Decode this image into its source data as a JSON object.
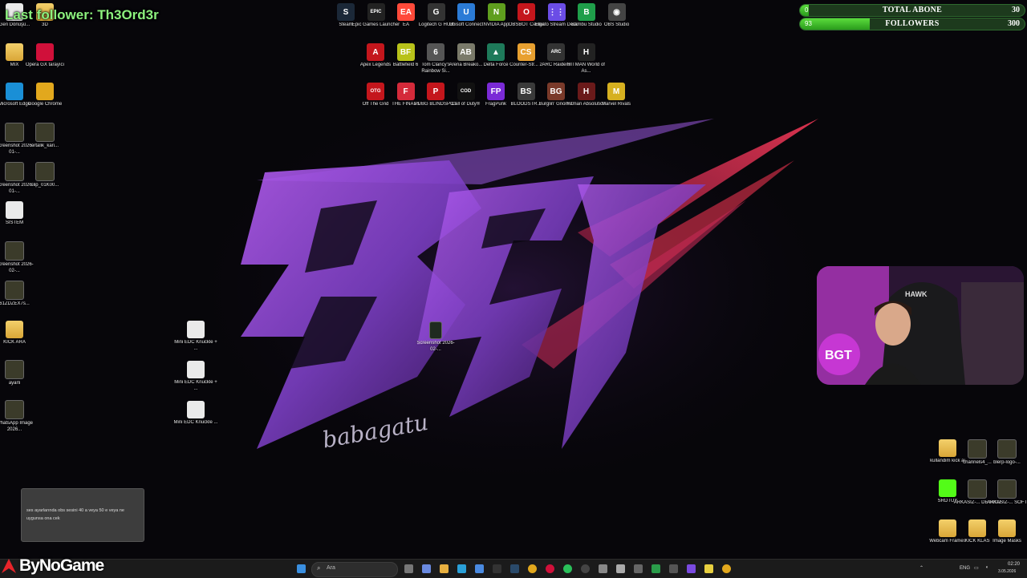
{
  "overlay": {
    "last_follower": "Last follower: Th3Ord3r"
  },
  "stats": [
    {
      "title": "TOTAL ABONE",
      "current": "0",
      "goal": "30",
      "fill_fraction": 0.04
    },
    {
      "title": "FOLLOWERS",
      "current": "93",
      "goal": "300",
      "fill_fraction": 0.31
    }
  ],
  "left_icons": [
    {
      "label": "Geri Dönüşü...",
      "icon": "recycle-bin-icon",
      "kind": "file"
    },
    {
      "label": "3D",
      "icon": "folder-icon",
      "kind": "folder"
    },
    {
      "label": "MIX",
      "icon": "folder-icon",
      "kind": "folder"
    },
    {
      "label": "Opera GX tarayıcı",
      "icon": "opera-gx-icon",
      "kind": "app",
      "color": "#d0103a"
    },
    {
      "label": "Microsoft Edge",
      "icon": "edge-icon",
      "kind": "app",
      "color": "#1a8fd6"
    },
    {
      "label": "Google Chrome",
      "icon": "chrome-icon",
      "kind": "app",
      "color": "#e2a81d"
    },
    {
      "label": "Screenshot 2026-01-...",
      "icon": "image-file-icon",
      "kind": "thumb"
    },
    {
      "label": "ortalik_kari...",
      "icon": "video-file-icon",
      "kind": "thumb"
    },
    {
      "label": "Screenshot 2026-01-...",
      "icon": "image-file-icon",
      "kind": "thumb"
    },
    {
      "label": "clip_01K00...",
      "icon": "video-file-icon",
      "kind": "thumb"
    },
    {
      "label": "SISTEM",
      "icon": "document-icon",
      "kind": "file"
    },
    {
      "label": "Screenshot 2026-02-...",
      "icon": "image-file-icon",
      "kind": "thumb"
    },
    {
      "label": "61ZDZEX7s...",
      "icon": "image-file-icon",
      "kind": "thumb"
    },
    {
      "label": "KICK ARA",
      "icon": "folder-icon",
      "kind": "folder"
    },
    {
      "label": "ayarli",
      "icon": "image-file-icon",
      "kind": "thumb"
    },
    {
      "label": "WhatsApp Image 2026...",
      "icon": "image-file-icon",
      "kind": "thumb"
    }
  ],
  "middle_icons": [
    {
      "label": "Mini EDC Knuckle + ...",
      "icon": "model-file-icon"
    },
    {
      "label": "Mini EDC Knuckle + ...",
      "icon": "model-file-icon"
    },
    {
      "label": "Mini EDC Knuckle ...",
      "icon": "model-file-icon"
    }
  ],
  "center_icon": {
    "label": "Screenshot 2026-02-...",
    "icon": "image-file-icon"
  },
  "top_apps_row1": [
    {
      "label": "Steam",
      "icon": "steam-icon",
      "color": "#1b2838",
      "glyph": "S"
    },
    {
      "label": "Epic Games Launcher",
      "icon": "epic-games-icon",
      "color": "#222",
      "glyph": "EPIC"
    },
    {
      "label": "EA",
      "icon": "ea-icon",
      "color": "#ff4a3a",
      "glyph": "EA"
    },
    {
      "label": "Logitech G HUB",
      "icon": "logitech-icon",
      "color": "#333",
      "glyph": "G"
    },
    {
      "label": "Ubisoft Connect",
      "icon": "ubisoft-icon",
      "color": "#2b7bd6",
      "glyph": "U"
    },
    {
      "label": "NVIDIA App",
      "icon": "nvidia-icon",
      "color": "#5f9e1e",
      "glyph": "N"
    },
    {
      "label": "OBSBOT Center",
      "icon": "obsbot-icon",
      "color": "#c4161c",
      "glyph": "O"
    },
    {
      "label": "Elgato Stream Deck",
      "icon": "stream-deck-icon",
      "color": "#6b4de6",
      "glyph": "⋮⋮"
    },
    {
      "label": "Bambu Studio",
      "icon": "bambu-icon",
      "color": "#1f9e4a",
      "glyph": "B"
    },
    {
      "label": "OBS Studio",
      "icon": "obs-icon",
      "color": "#444",
      "glyph": "◉"
    }
  ],
  "top_apps_row2": [
    {
      "label": "Apex Legends",
      "icon": "apex-icon",
      "color": "#c4161c",
      "glyph": "A"
    },
    {
      "label": "Battlefield 6",
      "icon": "battlefield-icon",
      "color": "#b8c21a",
      "glyph": "BF"
    },
    {
      "label": "Tom Clancy's Rainbow Si...",
      "icon": "rainbow-six-icon",
      "color": "#555",
      "glyph": "6"
    },
    {
      "label": "Arena Breako...",
      "icon": "arena-breakout-icon",
      "color": "#7a7a6a",
      "glyph": "AB"
    },
    {
      "label": "Delta Force",
      "icon": "delta-force-icon",
      "color": "#1e7a5a",
      "glyph": "▲"
    },
    {
      "label": "Counter-Str... 2",
      "icon": "cs2-icon",
      "color": "#e8a030",
      "glyph": "CS"
    },
    {
      "label": "ARC Raiders",
      "icon": "arc-raiders-icon",
      "color": "#333",
      "glyph": "ARC"
    },
    {
      "label": "HITMAN World of As...",
      "icon": "hitman-icon",
      "color": "#222",
      "glyph": "H"
    }
  ],
  "top_apps_row3": [
    {
      "label": "Off The Grid",
      "icon": "off-the-grid-icon",
      "color": "#c4161c",
      "glyph": "OTG"
    },
    {
      "label": "THE FINALS",
      "icon": "the-finals-icon",
      "color": "#d42a3a",
      "glyph": "F"
    },
    {
      "label": "PUBG BLINDSPOT",
      "icon": "pubg-icon",
      "color": "#c4161c",
      "glyph": "P"
    },
    {
      "label": "Call of Duty®",
      "icon": "call-of-duty-icon",
      "color": "#111",
      "glyph": "COD"
    },
    {
      "label": "FragPunk",
      "icon": "fragpunk-icon",
      "color": "#7a2ad6",
      "glyph": "FP"
    },
    {
      "label": "BLOODSTR...",
      "icon": "bloodstrike-icon",
      "color": "#3a3a3a",
      "glyph": "BS"
    },
    {
      "label": "Burglin' Gnom...",
      "icon": "burglin-gnomes-icon",
      "color": "#7a3a2a",
      "glyph": "BG"
    },
    {
      "label": "Hitman Absolution",
      "icon": "hitman-absolution-icon",
      "color": "#6a1a1a",
      "glyph": "H"
    },
    {
      "label": "Marvel Rivals",
      "icon": "marvel-rivals-icon",
      "color": "#d6b020",
      "glyph": "M"
    }
  ],
  "right_icons": [
    {
      "label": "kullandim kick ai",
      "icon": "folder-icon",
      "kind": "folder"
    },
    {
      "label": "channels4_...",
      "icon": "image-file-icon",
      "kind": "thumb"
    },
    {
      "label": "blerp-logo-...",
      "icon": "image-file-icon",
      "kind": "thumb"
    },
    {
      "label": "SRDTUY",
      "icon": "kick-icon",
      "kind": "app",
      "color": "#53fc18"
    },
    {
      "label": "ARKASIZ-... DETAYLI",
      "icon": "image-file-icon",
      "kind": "thumb"
    },
    {
      "label": "ARKASIZ-... SOFT",
      "icon": "image-file-icon",
      "kind": "thumb"
    },
    {
      "label": "Webcam Frames",
      "icon": "folder-icon",
      "kind": "folder"
    },
    {
      "label": "KICK KLAS",
      "icon": "folder-icon",
      "kind": "folder"
    },
    {
      "label": "Image Masks",
      "icon": "folder-icon",
      "kind": "folder"
    }
  ],
  "wallpaper": {
    "logo_text": "BGT",
    "signature": "babagatu"
  },
  "notification": {
    "text": "ses ayarlarında obs sesini 40 a veya 50 e veya ne uygunsa ona cek"
  },
  "brand": {
    "name": "ByNoGame"
  },
  "taskbar": {
    "search_placeholder": "Ara",
    "language": "ENG",
    "time": "02:20",
    "date": "3.05.2026"
  }
}
